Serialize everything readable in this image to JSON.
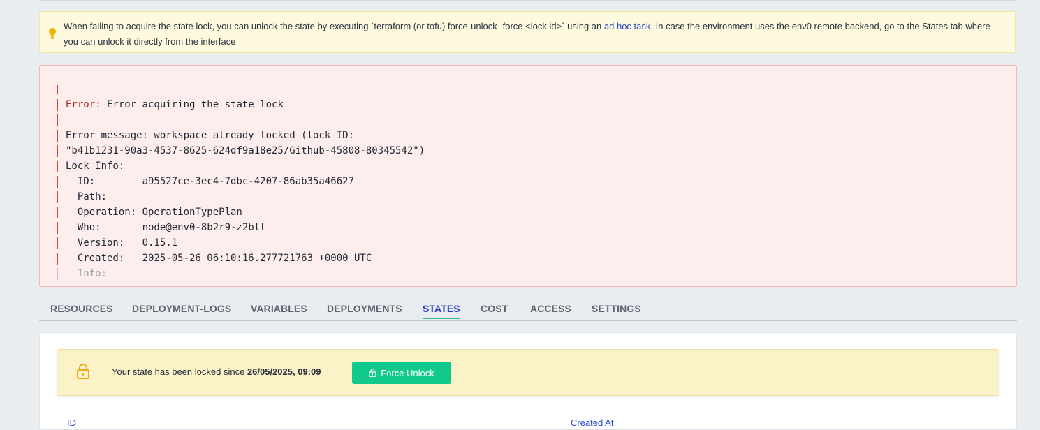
{
  "tip": {
    "text_before": "When failing to acquire the state lock, you can unlock the state by executing `terraform (or tofu) force-unlock -force <lock id>` using an ",
    "link_text": "ad hoc task",
    "text_after": ". In case the environment uses the env0 remote backend, go to the States tab where you can unlock it directly from the interface",
    "icon": "lightbulb-icon"
  },
  "error": {
    "keyword": "Error:",
    "title": " Error acquiring the state lock",
    "lines": [
      "Error message: workspace already locked (lock ID:",
      "\"b41b1231-90a3-4537-8625-624df9a18e25/Github-45808-80345542\")",
      "Lock Info:",
      "  ID:        a95527ce-3ec4-7dbc-4207-86ab35a46627",
      "  Path:",
      "  Operation: OperationTypePlan",
      "  Who:       node@env0-8b2r9-z2blt",
      "  Version:   0.15.1",
      "  Created:   2025-05-26 06:10:16.277721763 +0000 UTC"
    ],
    "faded_line": "  Info:"
  },
  "tabs": {
    "resources": "RESOURCES",
    "deployment_logs": "DEPLOYMENT-LOGS",
    "variables": "VARIABLES",
    "deployments": "DEPLOYMENTS",
    "states": "STATES",
    "cost": "COST",
    "access": "ACCESS",
    "settings": "SETTINGS",
    "active": "STATES"
  },
  "lock": {
    "text": "Your state has been locked since ",
    "since": "26/05/2025, 09:09",
    "button_label": "Force Unlock",
    "icon": "lock-icon"
  },
  "columns": {
    "id": "ID",
    "created_at": "Created At"
  },
  "colors": {
    "accent": "#2a38c8",
    "button": "#11c98a",
    "error_border": "#d64542",
    "warning_bg": "#fcf2c8"
  }
}
